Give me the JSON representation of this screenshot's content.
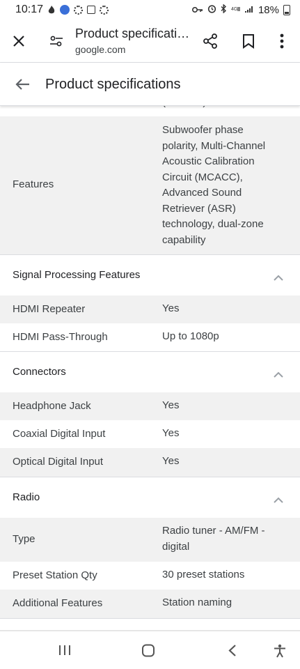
{
  "status_bar": {
    "time": "10:17",
    "battery": "18%",
    "icons_left": [
      "fire-icon",
      "samsung-app-icon",
      "gear-icon",
      "image-icon",
      "gear-icon"
    ],
    "icons_right": [
      "vpn-key-icon",
      "alarm-icon",
      "bluetooth-icon",
      "lte-icon",
      "signal-icon",
      "battery-icon"
    ]
  },
  "toolbar": {
    "title": "Product specificati…",
    "url": "google.com",
    "icons": [
      "close-icon",
      "page-settings-icon",
      "share-icon",
      "bookmark-icon",
      "more-vert-icon"
    ]
  },
  "subheader": {
    "title": "Product specifications",
    "back_icon": "arrow-back-icon"
  },
  "cut_off_row": {
    "value_fragment": "(… … …)"
  },
  "features_row": {
    "label": "Features",
    "value_lines": [
      "Subwoofer phase",
      "polarity, Multi-Channel",
      "Acoustic Calibration",
      "Circuit (MCACC),",
      "Advanced Sound",
      "Retriever (ASR)",
      "technology, dual-zone",
      "capability"
    ]
  },
  "sections": [
    {
      "title": "Signal Processing Features",
      "rows": [
        {
          "label": "HDMI Repeater",
          "value": "Yes"
        },
        {
          "label": "HDMI Pass-Through",
          "value": "Up to 1080p"
        }
      ]
    },
    {
      "title": "Connectors",
      "rows": [
        {
          "label": "Headphone Jack",
          "value": "Yes"
        },
        {
          "label": "Coaxial Digital Input",
          "value": "Yes"
        },
        {
          "label": "Optical Digital Input",
          "value": "Yes"
        }
      ]
    },
    {
      "title": "Radio",
      "rows": [
        {
          "label": "Type",
          "value_lines": [
            "Radio tuner - AM/FM -",
            "digital"
          ]
        },
        {
          "label": "Preset Station Qty",
          "value": "30 preset stations"
        },
        {
          "label": "Additional Features",
          "value": "Station naming"
        }
      ]
    }
  ],
  "nav_bar": {
    "icons": [
      "recents-icon",
      "home-icon",
      "back-icon",
      "accessibility-icon"
    ]
  },
  "colors": {
    "shaded_row": "#f1f1f1",
    "divider": "#dadce0",
    "text_primary": "#202124",
    "text_secondary": "#3c4043",
    "chevron": "#9aa0a6"
  }
}
